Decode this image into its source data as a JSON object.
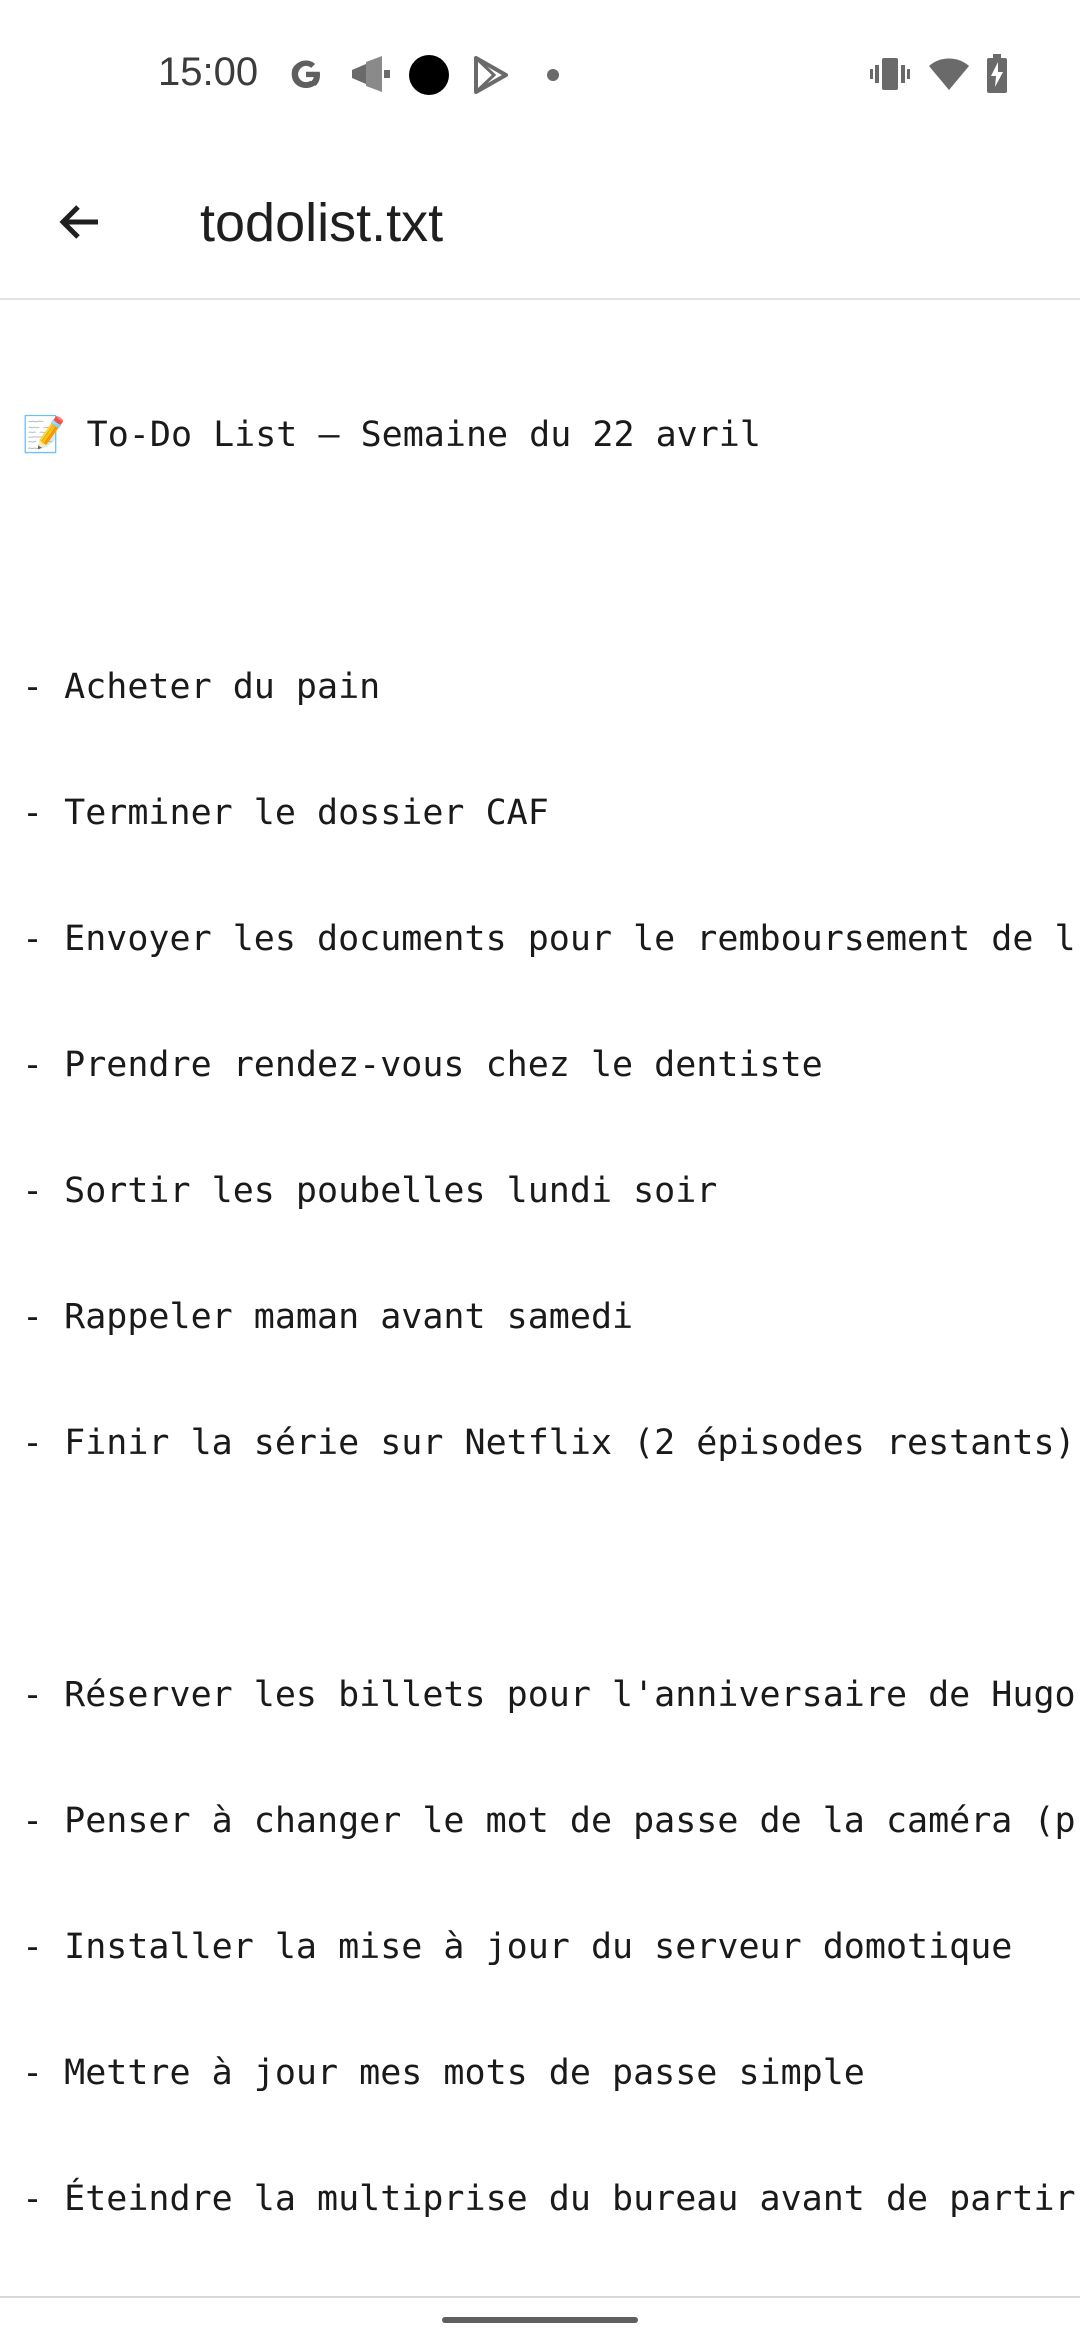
{
  "status_bar": {
    "time": "15:00",
    "left_icons": [
      "google-icon",
      "megaphone-icon",
      "dot-icon",
      "play-store-icon",
      "small-dot-icon"
    ],
    "right_icons": [
      "vibrate-icon",
      "wifi-icon",
      "battery-charging-icon"
    ]
  },
  "app_bar": {
    "title": "todolist.txt",
    "back_icon": "back-arrow-icon"
  },
  "document": {
    "lines": [
      "📝 To-Do List – Semaine du 22 avril",
      "",
      "- Acheter du pain",
      "- Terminer le dossier CAF",
      "- Envoyer les documents pour le remboursement de l",
      "- Prendre rendez-vous chez le dentiste",
      "- Sortir les poubelles lundi soir",
      "- Rappeler maman avant samedi",
      "- Finir la série sur Netflix (2 épisodes restants)",
      "",
      "- Réserver les billets pour l'anniversaire de Hugo",
      "- Penser à changer le mot de passe de la caméra (p",
      "- Installer la mise à jour du serveur domotique",
      "- Mettre à jour mes mots de passe simple",
      "- Éteindre la multiprise du bureau avant de partir"
    ]
  }
}
